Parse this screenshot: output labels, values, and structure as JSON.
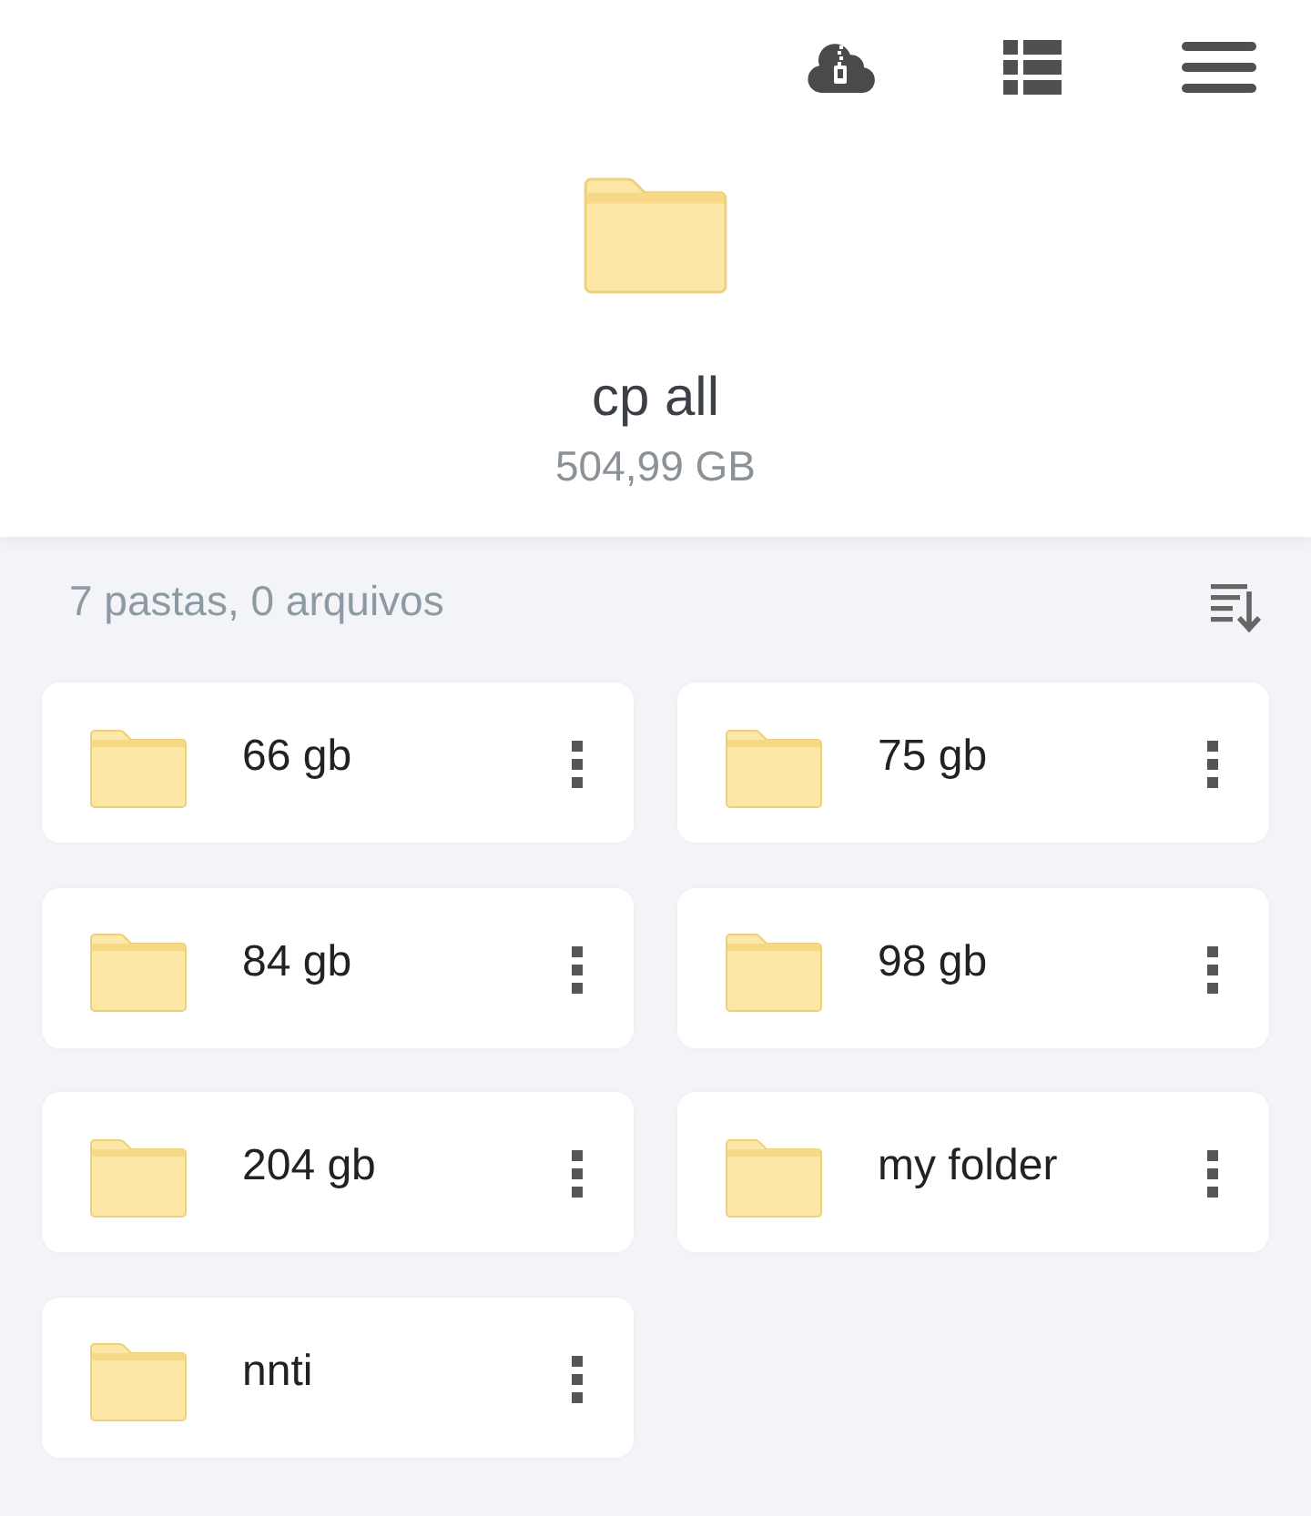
{
  "folder": {
    "name": "cp all",
    "size": "504,99 GB"
  },
  "summary": "7 pastas, 0 arquivos",
  "items": [
    {
      "name": "66 gb"
    },
    {
      "name": "75 gb"
    },
    {
      "name": "84 gb"
    },
    {
      "name": "98 gb"
    },
    {
      "name": "204 gb"
    },
    {
      "name": "my folder"
    },
    {
      "name": "nnti"
    }
  ]
}
